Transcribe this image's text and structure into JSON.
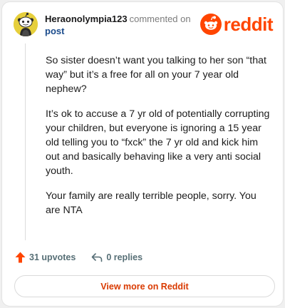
{
  "comment": {
    "username": "Heraonolympia123",
    "action_text": "commented on",
    "post_link": "post",
    "paragraphs": [
      "So sister doesn’t want you talking to her son “that way” but it’s a free for all on your 7 year old nephew?",
      "It’s ok to accuse a 7 yr old of potentially corrupting your children, but everyone is ignoring a 15 year old telling you to “fxck” the 7 yr old and kick him out and basically behaving like a very anti social youth.",
      "Your family are really terrible people, sorry. You are NTA"
    ]
  },
  "brand": {
    "wordmark": "reddit",
    "color": "#ff4500"
  },
  "actions": {
    "upvotes_label": "31 upvotes",
    "replies_label": "0 replies"
  },
  "footer": {
    "view_more_label": "View more on Reddit"
  },
  "icons": {
    "avatar": "snoo-avatar-icon",
    "logo": "reddit-snoo-icon",
    "upvote": "upvote-arrow-icon",
    "reply": "reply-arrow-icon"
  },
  "colors": {
    "accent": "#ff4500",
    "link": "#1a4b8c",
    "view_more_text": "#d93a00",
    "avatar_bg": "#e6cf3c",
    "muted": "#576f76"
  }
}
